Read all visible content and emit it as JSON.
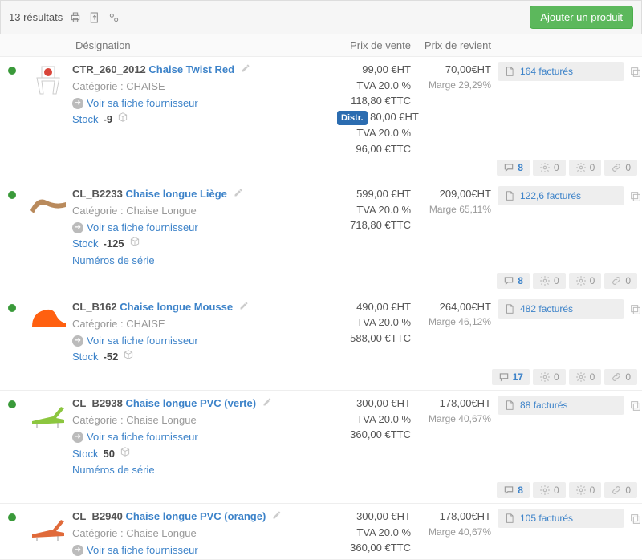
{
  "topbar": {
    "results_text": "13 résultats",
    "add_button": "Ajouter un produit"
  },
  "headers": {
    "designation": "Désignation",
    "sale_price": "Prix de vente",
    "cost_price": "Prix de revient"
  },
  "labels": {
    "category": "Catégorie :",
    "supplier_link": "Voir sa fiche fournisseur",
    "stock": "Stock",
    "serials": "Numéros de série",
    "factures_suffix": "facturés",
    "distr": "Distr."
  },
  "footer": {
    "gear_b": "0",
    "gear_c": "0",
    "chain": "0"
  },
  "products": [
    {
      "sku": "CTR_260_2012",
      "name": "Chaise Twist Red",
      "category": "CHAISE",
      "stock": "-9",
      "show_serials": false,
      "price_ht": "99,00 €HT",
      "tva": "TVA 20.0 %",
      "price_ttc": "118,80 €TTC",
      "distr_ht": "80,00 €HT",
      "distr_tva": "TVA 20.0 %",
      "distr_ttc": "96,00 €TTC",
      "cost_ht": "70,00€HT",
      "margin": "Marge 29,29%",
      "factures": "164",
      "comments": "8",
      "thumb_color": "#d9453a",
      "thumb_shape": "chair"
    },
    {
      "sku": "CL_B2233",
      "name": "Chaise longue Liège",
      "category": "Chaise Longue",
      "stock": "-125",
      "show_serials": true,
      "price_ht": "599,00 €HT",
      "tva": "TVA 20.0 %",
      "price_ttc": "718,80 €TTC",
      "cost_ht": "209,00€HT",
      "margin": "Marge 65,11%",
      "factures": "122,6",
      "comments": "8",
      "thumb_color": "#b98a5c",
      "thumb_shape": "lounge"
    },
    {
      "sku": "CL_B162",
      "name": "Chaise longue Mousse",
      "category": "CHAISE",
      "stock": "-52",
      "show_serials": false,
      "price_ht": "490,00 €HT",
      "tva": "TVA 20.0 %",
      "price_ttc": "588,00 €TTC",
      "cost_ht": "264,00€HT",
      "margin": "Marge 46,12%",
      "factures": "482",
      "comments": "17",
      "thumb_color": "#ff6010",
      "thumb_shape": "blob"
    },
    {
      "sku": "CL_B2938",
      "name": "Chaise longue PVC (verte)",
      "category": "Chaise Longue",
      "stock": "50",
      "show_serials": true,
      "price_ht": "300,00 €HT",
      "tva": "TVA 20.0 %",
      "price_ttc": "360,00 €TTC",
      "cost_ht": "178,00€HT",
      "margin": "Marge 40,67%",
      "factures": "88",
      "comments": "8",
      "thumb_color": "#8cc63f",
      "thumb_shape": "deck"
    },
    {
      "sku": "CL_B2940",
      "name": "Chaise longue PVC (orange)",
      "category": "Chaise Longue",
      "stock": "",
      "show_serials": false,
      "price_ht": "300,00 €HT",
      "tva": "TVA 20.0 %",
      "price_ttc": "360,00 €TTC",
      "cost_ht": "178,00€HT",
      "margin": "Marge 40,67%",
      "factures": "105",
      "comments": "",
      "thumb_color": "#e06a3a",
      "thumb_shape": "deck",
      "hide_footer": true,
      "hide_stock": true
    }
  ]
}
